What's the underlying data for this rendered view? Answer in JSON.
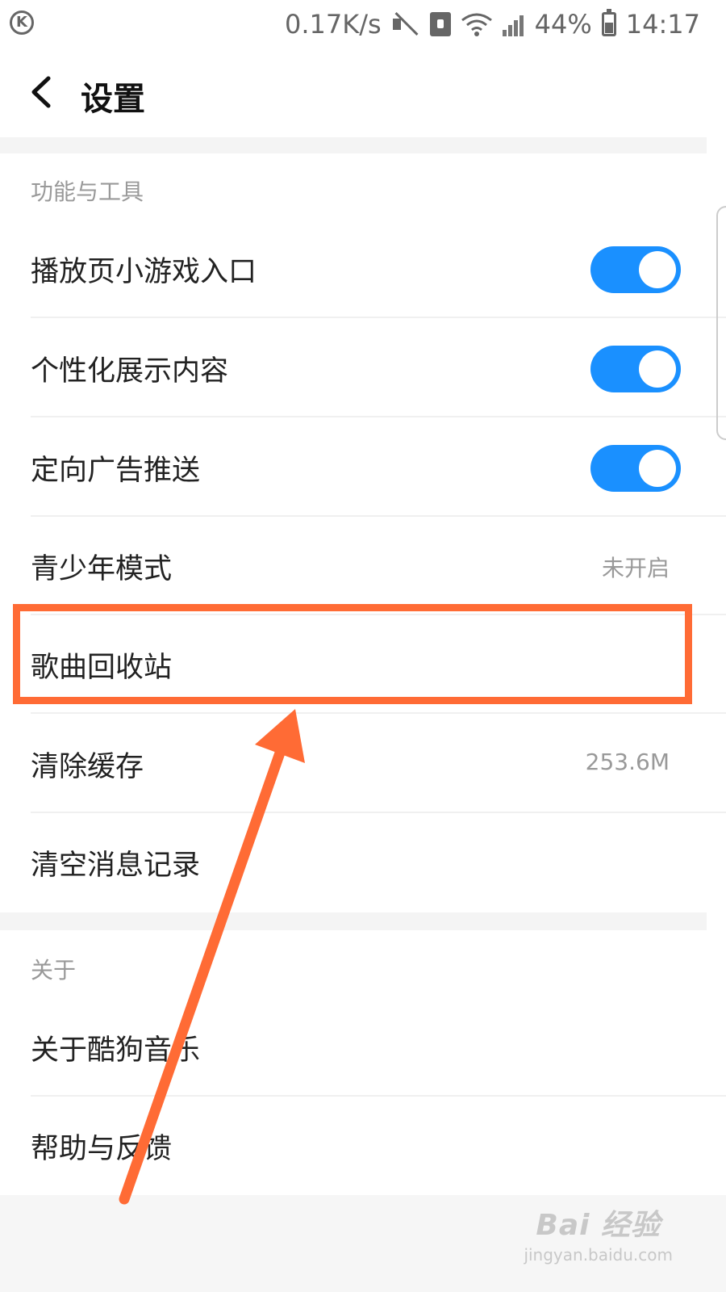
{
  "status_bar": {
    "net_speed": "0.17K/s",
    "battery": "44%",
    "time": "14:17"
  },
  "header": {
    "title": "设置"
  },
  "sections": {
    "tools": {
      "title": "功能与工具",
      "items": [
        {
          "label": "播放页小游戏入口",
          "toggle": true
        },
        {
          "label": "个性化展示内容",
          "toggle": true
        },
        {
          "label": "定向广告推送",
          "toggle": true
        },
        {
          "label": "青少年模式",
          "value": "未开启"
        },
        {
          "label": "歌曲回收站"
        },
        {
          "label": "清除缓存",
          "value": "253.6M"
        },
        {
          "label": "清空消息记录"
        }
      ]
    },
    "about": {
      "title": "关于",
      "items": [
        {
          "label": "关于酷狗音乐"
        },
        {
          "label": "帮助与反馈"
        }
      ]
    }
  },
  "watermark": {
    "main": "Bai 经验",
    "sub": "jingyan.baidu.com"
  },
  "colors": {
    "toggle_on": "#1a90ff",
    "annotation": "#ff6b35"
  }
}
